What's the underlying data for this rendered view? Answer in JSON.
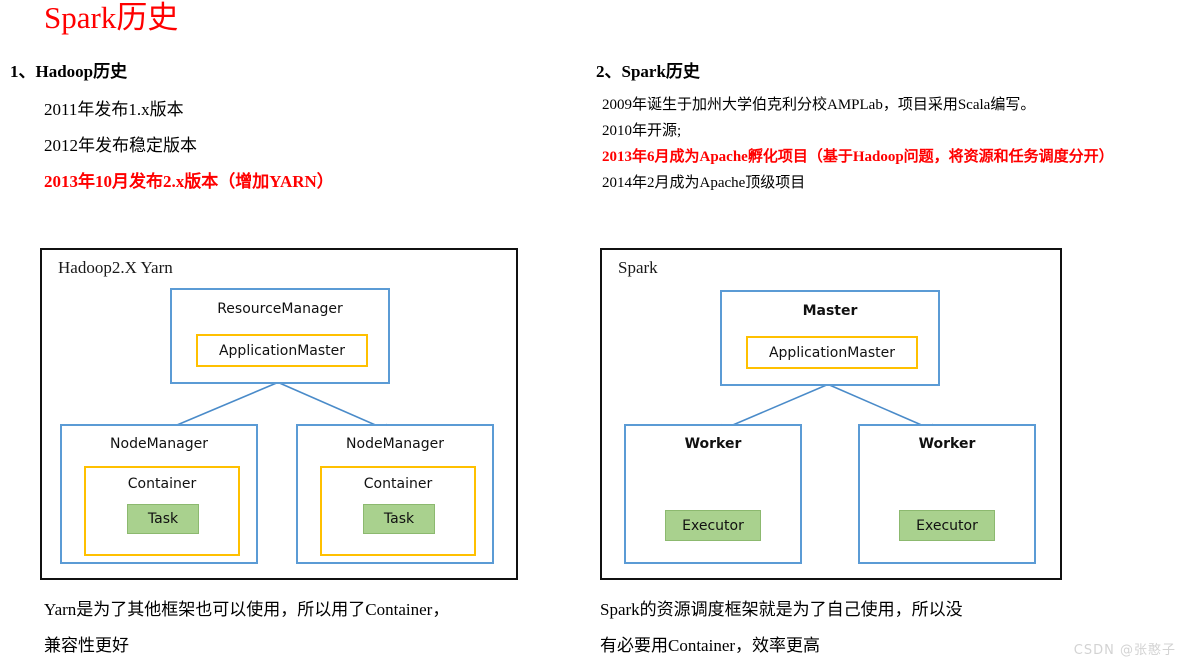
{
  "slide": {
    "title": "Spark历史",
    "title_color": "#ff0000",
    "watermark": "CSDN @张憨子"
  },
  "left_column": {
    "heading_number": "1、",
    "heading_text": "Hadoop历史",
    "bullets": [
      {
        "text": "2011年发布1.x版本",
        "color": "#000000",
        "bold": false
      },
      {
        "text": "2012年发布稳定版本",
        "color": "#000000",
        "bold": false
      },
      {
        "text": "2013年10月发布2.x版本（增加YARN）",
        "color": "#ff0000",
        "bold": true
      }
    ],
    "caption_line1": "Yarn是为了其他框架也可以使用，所以用了Container，",
    "caption_line2": "兼容性更好"
  },
  "right_column": {
    "heading_number": "2、",
    "heading_text": "Spark历史",
    "bullets": [
      {
        "text": "2009年诞生于加州大学伯克利分校AMPLab，项目采用Scala编写。",
        "color": "#000000",
        "bold": false
      },
      {
        "text": "2010年开源;",
        "color": "#000000",
        "bold": false
      },
      {
        "text": "2013年6月成为Apache孵化项目（基于Hadoop问题，将资源和任务调度分开）",
        "color": "#ff0000",
        "bold": true
      },
      {
        "text": "2014年2月成为Apache顶级项目",
        "color": "#000000",
        "bold": false
      }
    ],
    "caption_line1": "Spark的资源调度框架就是为了自己使用，所以没",
    "caption_line2": "有必要用Container，效率更高"
  },
  "diagram_hadoop": {
    "frame_label": "Hadoop2.X Yarn",
    "master_node": "ResourceManager",
    "master_inner": "ApplicationMaster",
    "worker_left": "NodeManager",
    "worker_right": "NodeManager",
    "container_left": "Container",
    "container_right": "Container",
    "task_left": "Task",
    "task_right": "Task"
  },
  "diagram_spark": {
    "frame_label": "Spark",
    "master_node": "Master",
    "master_inner": "ApplicationMaster",
    "worker_left": "Worker",
    "worker_right": "Worker",
    "executor_left": "Executor",
    "executor_right": "Executor"
  },
  "colors": {
    "blue_border": "#5b9bd5",
    "orange_border": "#ffc000",
    "green_fill": "#a9d18e",
    "frame_border": "#111111",
    "accent_red": "#ff0000"
  }
}
